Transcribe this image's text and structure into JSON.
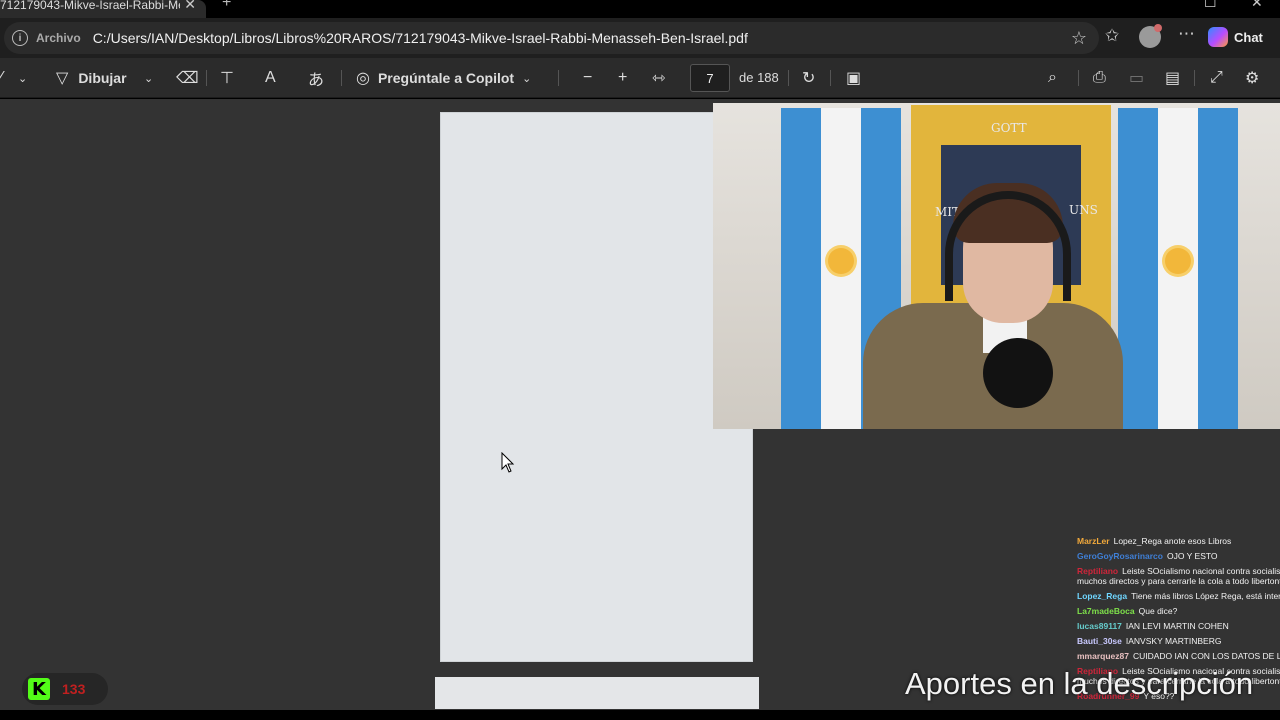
{
  "browser": {
    "tab_title": "712179043-Mikve-Israel-Rabbi-Me",
    "tab_close": "✕",
    "new_tab": "+",
    "address_label": "Archivo",
    "url": "C:/Users/IAN/Desktop/Libros/Libros%20RAROS/712179043-Mikve-Israel-Rabbi-Menasseh-Ben-Israel.pdf",
    "chat_label": "Chat"
  },
  "pdf_toolbar": {
    "draw_label": "Dibujar",
    "copilot_label": "Pregúntale a Copilot",
    "page_current": "7",
    "page_total": "de 188"
  },
  "chat_overlay": {
    "messages": [
      {
        "user": "MarzLer",
        "color": "#f2a93b",
        "text": "Lopez_Rega anote esos Libros",
        "extra": ""
      },
      {
        "user": "GeroGoyRosarinarco",
        "color": "#3f7fd6",
        "text": "OJO Y ESTO",
        "extra": ""
      },
      {
        "user": "Reptiliano",
        "color": "#d0253a",
        "text": "Leiste SOcialismo nacional contra socialis",
        "extra": "muchos directos y para cerrarle la cola a todo libertonto"
      },
      {
        "user": "Lopez_Rega",
        "color": "#6fd6ff",
        "text": "Tiene más libros López Rega, está intere",
        "extra": ""
      },
      {
        "user": "La7madeBoca",
        "color": "#7ee04a",
        "text": "Que dice?",
        "extra": ""
      },
      {
        "user": "lucas89117",
        "color": "#66cccc",
        "text": "IAN LEVI MARTIN COHEN",
        "extra": ""
      },
      {
        "user": "Bauti_30se",
        "color": "#c9c9ff",
        "text": "IANVSKY MARTINBERG",
        "extra": ""
      },
      {
        "user": "mmarquez87",
        "color": "#e8c0c0",
        "text": "CUIDADO IAN CON LOS DATOS DE LA",
        "extra": ""
      },
      {
        "user": "Reptiliano",
        "color": "#d0253a",
        "text": "Leiste SOcialismo nacional contra socialis",
        "extra": "muchos directos y para cerrarle la cola a todo libertonto"
      },
      {
        "user": "Roadrunner_99",
        "color": "#d0253a",
        "text": "Y eso??",
        "extra": ""
      }
    ]
  },
  "overlay": {
    "caption": "Aportes en la descripción",
    "kick_logo": "K",
    "kick_count": "133"
  },
  "webcam_banner": {
    "top_text": "GOTT",
    "left_text": "MIT",
    "right_text": "UNS"
  }
}
